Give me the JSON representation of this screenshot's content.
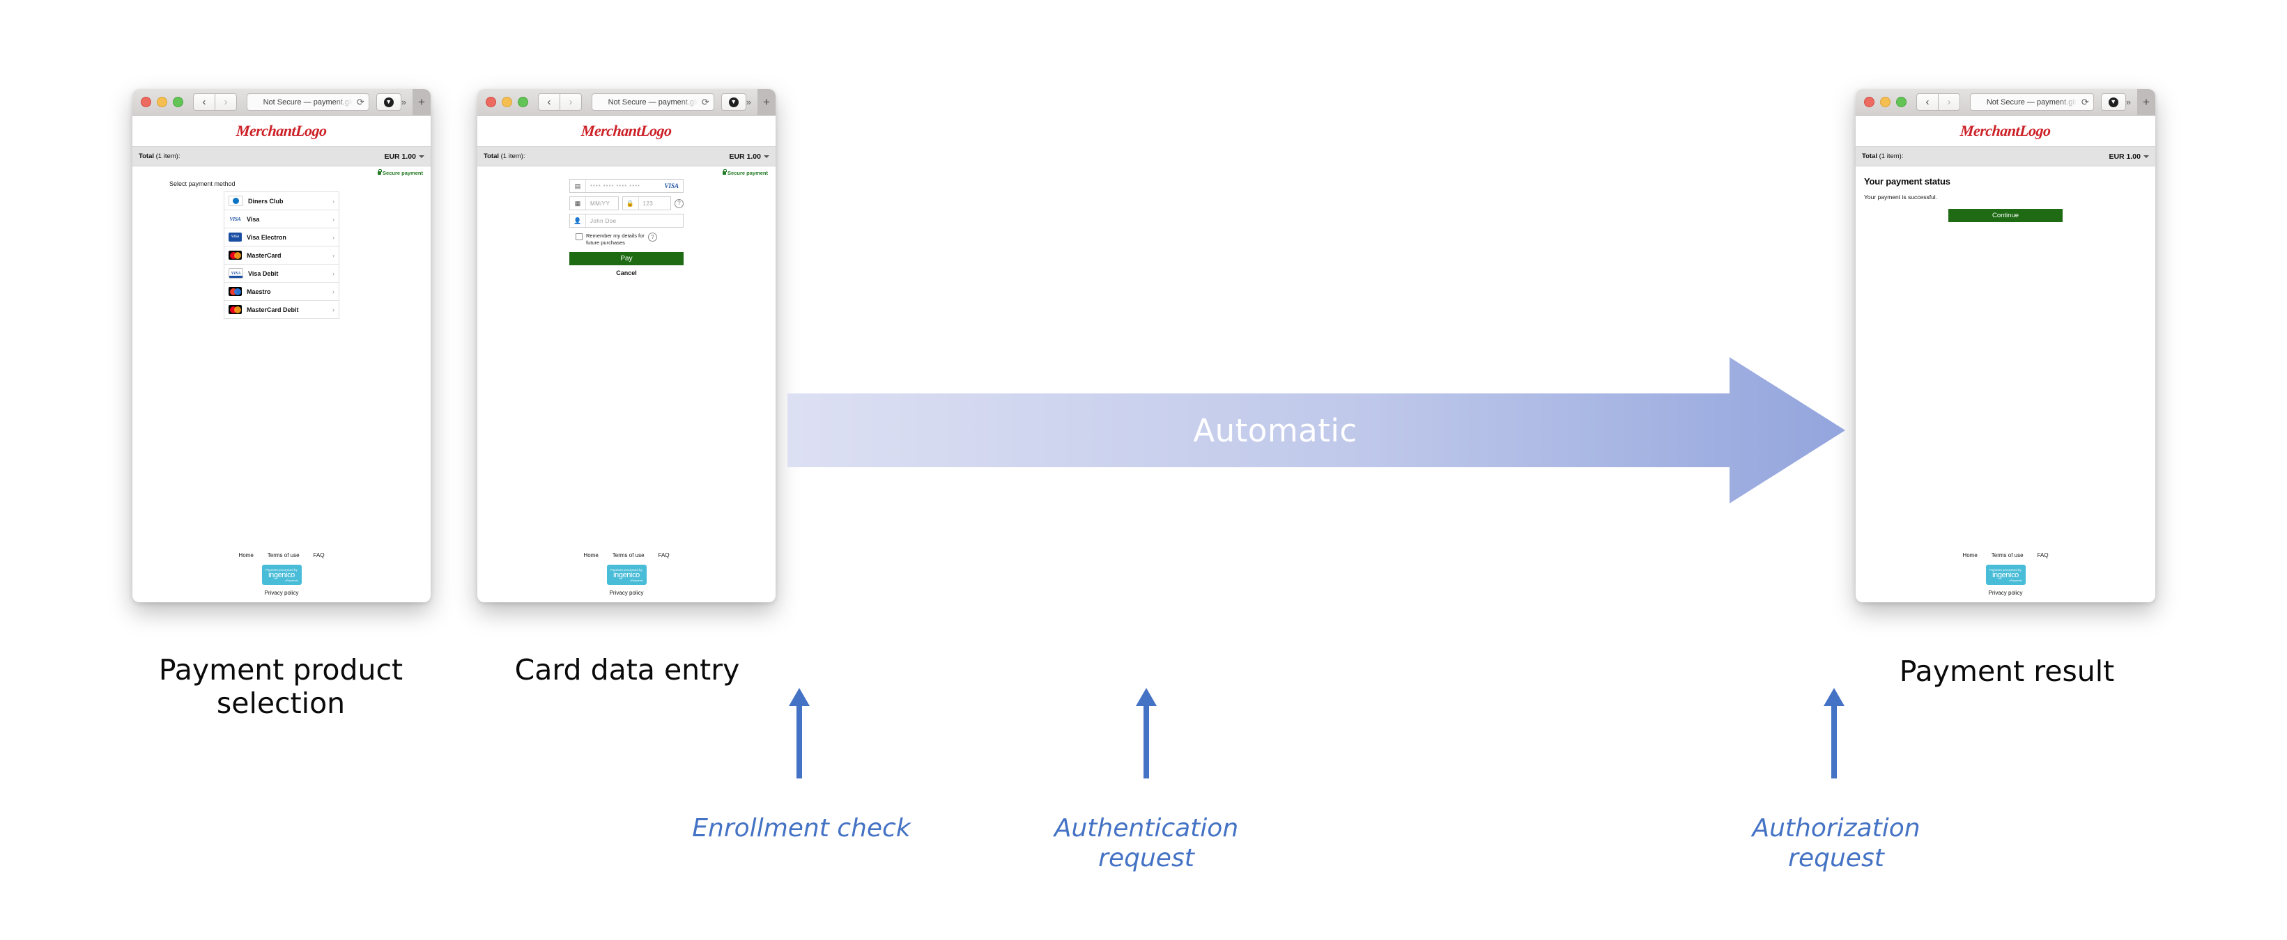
{
  "browser": {
    "url_text": "Not Secure — payment.glob",
    "reload_icon": "reload-icon",
    "download_icon": "download-icon",
    "more_icon": "chevron-double-right-icon",
    "new_tab_icon": "plus-icon",
    "back_icon": "chevron-left-icon",
    "forward_icon": "chevron-right-icon"
  },
  "merchant": {
    "logo_text": "MerchantLogo"
  },
  "total": {
    "label_bold": "Total",
    "label_rest": " (1 item):",
    "amount": "EUR 1.00"
  },
  "secure": {
    "text": "Secure payment"
  },
  "footer": {
    "links": [
      "Home",
      "Terms of use",
      "FAQ"
    ],
    "badge_top": "Payment processed by",
    "badge_main": "ingenico",
    "badge_sub": "ePayments",
    "privacy": "Privacy policy"
  },
  "screen1": {
    "select_title": "Select payment method",
    "methods": [
      {
        "name": "Diners Club",
        "brand": "diners"
      },
      {
        "name": "Visa",
        "brand": "visa"
      },
      {
        "name": "Visa Electron",
        "brand": "visaelectron"
      },
      {
        "name": "MasterCard",
        "brand": "mc"
      },
      {
        "name": "Visa Debit",
        "brand": "visadebit"
      },
      {
        "name": "Maestro",
        "brand": "maestro"
      },
      {
        "name": "MasterCard Debit",
        "brand": "mcdebit"
      }
    ],
    "arrow_glyph": "›"
  },
  "screen2": {
    "card_number_value": "**** **** **** ****",
    "card_brand": "VISA",
    "expiry_placeholder": "MM/YY",
    "cvc_placeholder": "123",
    "name_placeholder": "John Doe",
    "remember_label": "Remember my details for future purchases",
    "pay_button": "Pay",
    "cancel_button": "Cancel",
    "help_glyph": "?",
    "card_icon": "credit-card-icon",
    "calendar_icon": "calendar-icon",
    "lock_icon": "lock-icon",
    "person_icon": "person-icon"
  },
  "screen3": {
    "heading": "Your payment status",
    "message": "Your payment is successful.",
    "continue_button": "Continue"
  },
  "flow": {
    "automatic_label": "Automatic",
    "captions": [
      {
        "text": "Payment product\nselection"
      },
      {
        "text": "Card data entry"
      },
      {
        "text": "Payment result"
      }
    ],
    "annotations": [
      {
        "text": "Enrollment check"
      },
      {
        "text": "Authentication\nrequest"
      },
      {
        "text": "Authorization\nrequest"
      }
    ]
  },
  "colors": {
    "arrow_blue": "#4472C4",
    "pay_green": "#1e6b14",
    "secure_green": "#217a21",
    "logo_red": "#cc2026",
    "ingenico_cyan": "#49bcd8"
  }
}
